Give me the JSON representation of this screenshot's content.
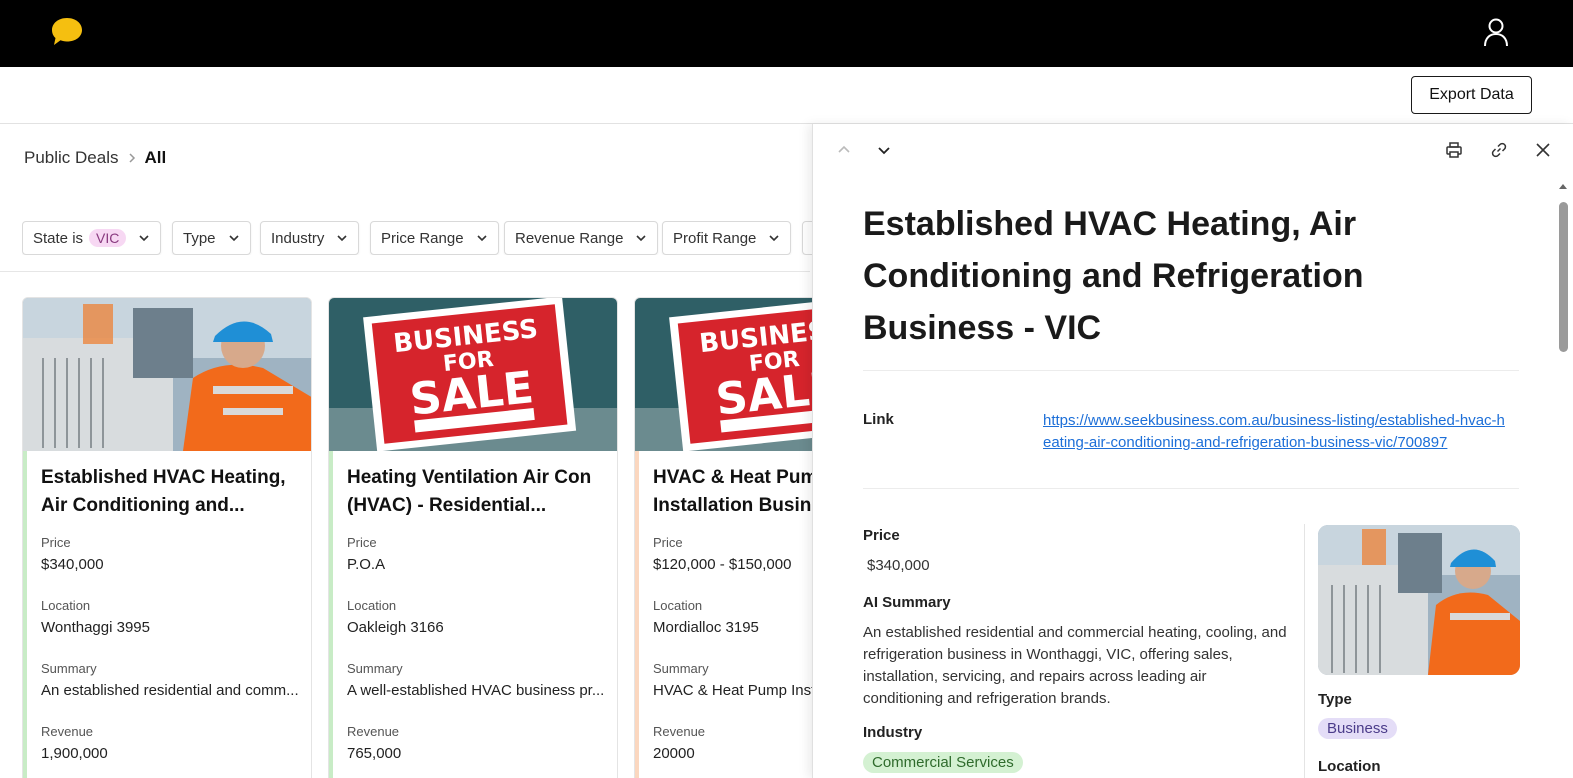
{
  "header": {
    "logo_icon": "chat-bubble-icon",
    "user_icon": "user-icon",
    "logo_color": "#f5bf10"
  },
  "toolbar": {
    "export_label": "Export Data"
  },
  "breadcrumb": {
    "root": "Public Deals",
    "current": "All"
  },
  "filters": {
    "state_prefix": "State is",
    "state_value": "VIC",
    "type": "Type",
    "industry": "Industry",
    "price_range": "Price Range",
    "revenue_range": "Revenue Range",
    "profit_range": "Profit Range"
  },
  "listing": {
    "labels": {
      "price": "Price",
      "location": "Location",
      "summary": "Summary",
      "revenue": "Revenue"
    },
    "cards": [
      {
        "title": "Established HVAC Heating, Air Conditioning and...",
        "price": "$340,000",
        "location": "Wonthaggi 3995",
        "summary": "An established residential and comm...",
        "revenue": "1,900,000",
        "accent": "#c8ecc6",
        "image": "hvac-technician-photo"
      },
      {
        "title": "Heating Ventilation Air Con (HVAC) - Residential...",
        "price": "P.O.A",
        "location": "Oakleigh 3166",
        "summary": "A well-established HVAC business pr...",
        "revenue": "765,000",
        "accent": "#c8ecc6",
        "image": "business-for-sale-sign"
      },
      {
        "title": "HVAC & Heat Pump Installation Busin",
        "price": "$120,000 - $150,000",
        "location": "Mordialloc 3195",
        "summary": "HVAC & Heat Pump Inst",
        "revenue": "20000",
        "accent": "#fbd7bf",
        "image": "business-for-sale-sign"
      }
    ]
  },
  "sign": {
    "line1": "BUSINESS",
    "line2": "FOR",
    "line3": "SALE"
  },
  "panel": {
    "title": "Established HVAC Heating, Air Conditioning and Refrigeration Business - VIC",
    "link_label": "Link",
    "link_url": "https://www.seekbusiness.com.au/business-listing/established-hvac-heating-air-conditioning-and-refrigeration-business-vic/700897",
    "price_label": "Price",
    "price": "$340,000",
    "ai_summary_label": "AI Summary",
    "ai_summary": "An established residential and commercial heating, cooling, and refrigeration business in Wonthaggi, VIC, offering sales, installation, servicing, and repairs across leading air conditioning and refrigeration brands.",
    "industry_label": "Industry",
    "industry": "Commercial Services",
    "type_label": "Type",
    "type": "Business",
    "location_label": "Location",
    "icons": [
      "chevron-up-icon",
      "chevron-down-icon",
      "print-icon",
      "link-icon",
      "close-icon"
    ]
  }
}
